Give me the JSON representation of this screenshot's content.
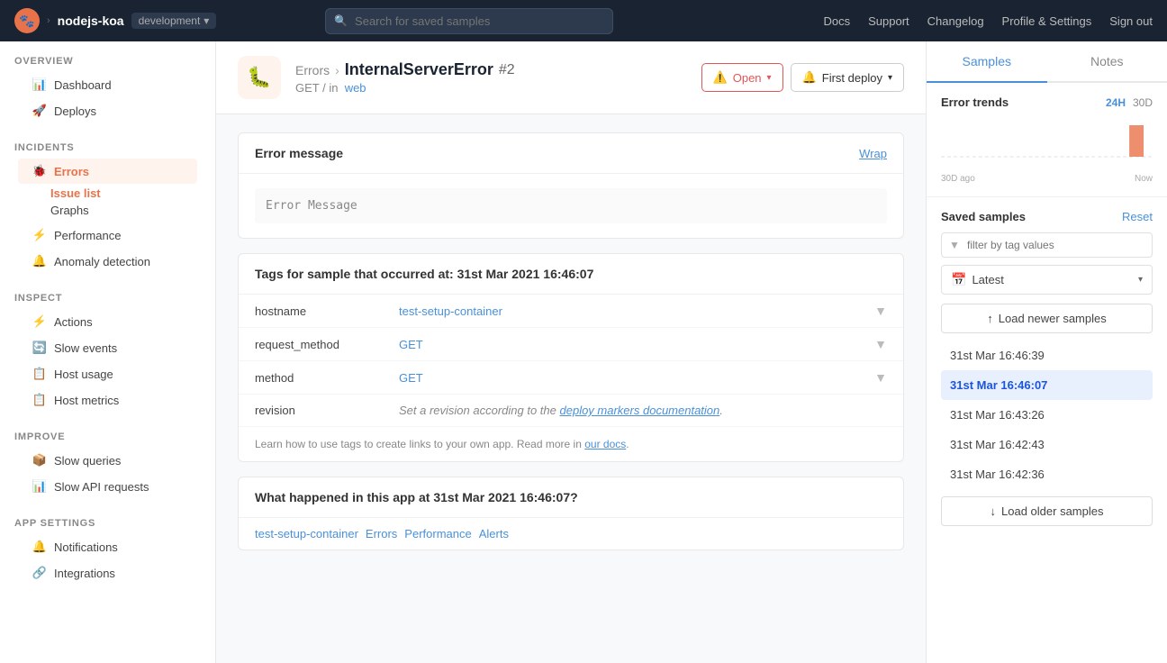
{
  "topnav": {
    "logo_text": "🐾",
    "app_name": "nodejs-koa",
    "env_name": "development",
    "search_placeholder": "Search for saved samples",
    "links": [
      "Docs",
      "Support",
      "Changelog",
      "Profile & Settings",
      "Sign out"
    ]
  },
  "sidebar": {
    "overview_title": "OVERVIEW",
    "overview_items": [
      {
        "label": "Dashboard",
        "icon": "📊",
        "active": false
      },
      {
        "label": "Deploys",
        "icon": "🚀",
        "active": false
      }
    ],
    "incidents_title": "INCIDENTS",
    "incidents_items": [
      {
        "label": "Errors",
        "icon": "🐞",
        "active": true
      }
    ],
    "incidents_sub": [
      {
        "label": "Issue list",
        "active": true
      },
      {
        "label": "Graphs",
        "active": false
      }
    ],
    "performance_title": "",
    "performance_item": {
      "label": "Performance",
      "icon": "⚡"
    },
    "anomaly_item": {
      "label": "Anomaly detection",
      "icon": "🔔"
    },
    "inspect_title": "INSPECT",
    "inspect_items": [
      {
        "label": "Actions",
        "icon": "⚡"
      },
      {
        "label": "Slow events",
        "icon": "🔄"
      },
      {
        "label": "Host usage",
        "icon": "📋"
      },
      {
        "label": "Host metrics",
        "icon": "📋"
      }
    ],
    "improve_title": "IMPROVE",
    "improve_items": [
      {
        "label": "Slow queries",
        "icon": "📦"
      },
      {
        "label": "Slow API requests",
        "icon": "📊"
      }
    ],
    "app_settings_title": "APP SETTINGS",
    "app_settings_items": [
      {
        "label": "Notifications",
        "icon": "🔔"
      },
      {
        "label": "Integrations",
        "icon": "🔗"
      }
    ]
  },
  "page_header": {
    "error_icon": "🐛",
    "breadcrumb_errors": "Errors",
    "breadcrumb_sep": "›",
    "error_name": "InternalServerError",
    "error_num": "#2",
    "error_method": "GET / in",
    "error_context": "web",
    "btn_open": "Open",
    "btn_first_deploy": "First deploy"
  },
  "error_message_card": {
    "title": "Error message",
    "wrap_label": "Wrap",
    "message_text": "Error Message"
  },
  "tags_card": {
    "title_prefix": "Tags for sample that occurred at:",
    "occurred_at": "31st Mar 2021 16:46:07",
    "rows": [
      {
        "key": "hostname",
        "value": "test-setup-container",
        "italic": false
      },
      {
        "key": "request_method",
        "value": "GET",
        "italic": false
      },
      {
        "key": "method",
        "value": "GET",
        "italic": false
      },
      {
        "key": "revision",
        "value": "Set a revision according to the deploy markers documentation.",
        "italic": true
      }
    ],
    "note": "Learn how to use tags to create links to your own app. Read more in",
    "note_link": "our docs"
  },
  "what_happened": {
    "title_prefix": "What happened in this app at",
    "occurred_at": "31st Mar 2021 16:46:07?",
    "tags": [
      "test-setup-container",
      "Errors",
      "Performance",
      "Alerts"
    ]
  },
  "right_panel": {
    "tab_samples": "Samples",
    "tab_notes": "Notes",
    "trends_title": "Error trends",
    "trends_24h": "24H",
    "trends_30d": "30D",
    "axis_left": "30D ago",
    "axis_right": "Now",
    "saved_title": "Saved samples",
    "reset_label": "Reset",
    "filter_placeholder": "filter by tag values",
    "dropdown_label": "Latest",
    "load_newer": "Load newer samples",
    "load_older": "Load older samples",
    "samples": [
      {
        "time": "31st Mar 16:46:39",
        "active": false
      },
      {
        "time": "31st Mar 16:46:07",
        "active": true
      },
      {
        "time": "31st Mar 16:43:26",
        "active": false
      },
      {
        "time": "31st Mar 16:42:43",
        "active": false
      },
      {
        "time": "31st Mar 16:42:36",
        "active": false
      }
    ]
  }
}
